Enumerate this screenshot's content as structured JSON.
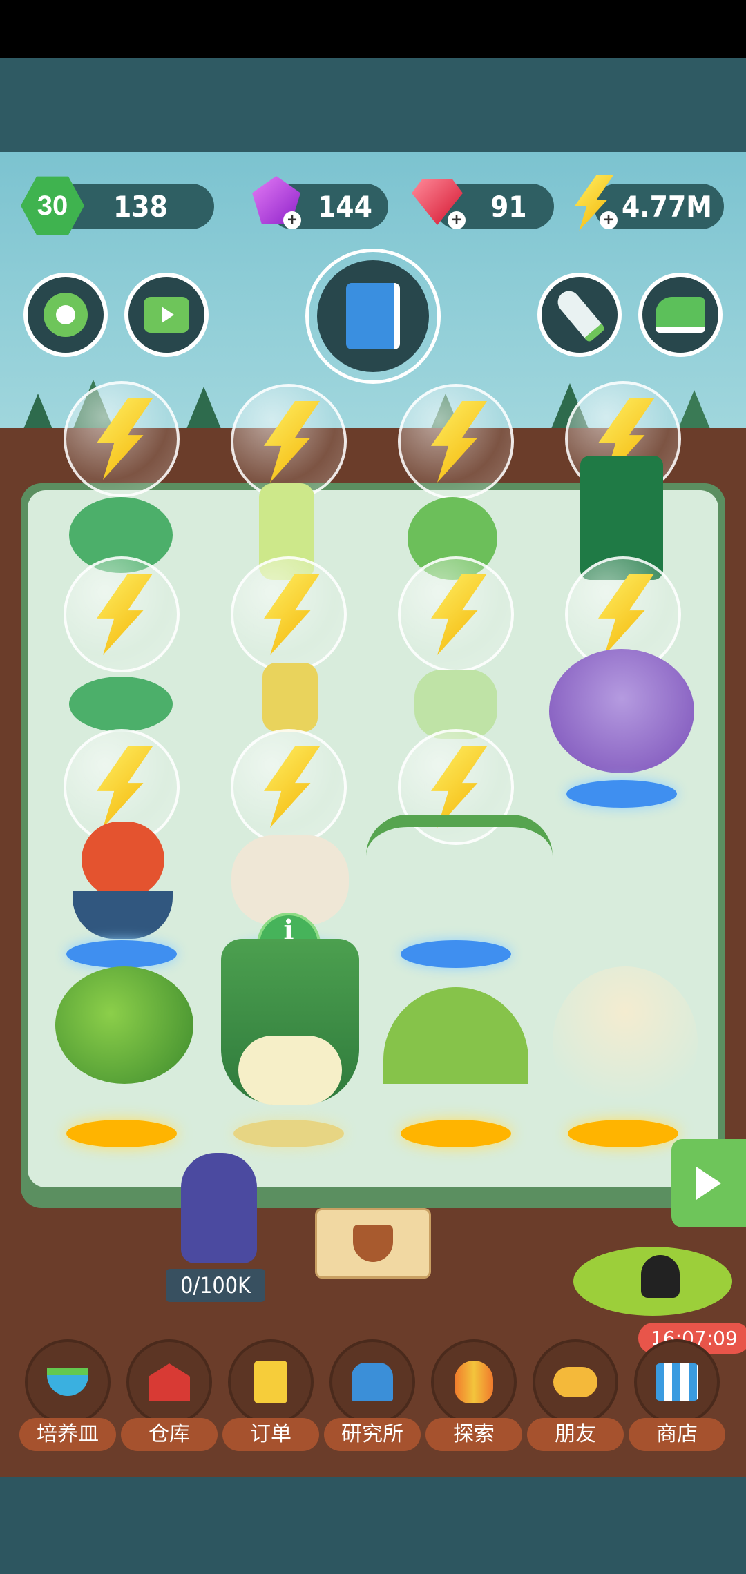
{
  "header": {
    "level": "30",
    "coins": "138",
    "gems": "144",
    "rubies": "91",
    "energy": "4.77M"
  },
  "quest": {
    "progress_label": "0/100K"
  },
  "info_button": {
    "label": "信息"
  },
  "shop_timer": "16:07:09",
  "nav": [
    {
      "label": "培养皿",
      "icon": "seedling-icon"
    },
    {
      "label": "仓库",
      "icon": "barn-icon"
    },
    {
      "label": "订单",
      "icon": "scroll-icon"
    },
    {
      "label": "研究所",
      "icon": "lab-icon"
    },
    {
      "label": "探索",
      "icon": "balloon-icon"
    },
    {
      "label": "朋友",
      "icon": "friends-icon"
    },
    {
      "label": "商店",
      "icon": "shop-icon"
    }
  ],
  "colors": {
    "accent_green": "#3fb34f",
    "field": "#d8ecdc",
    "nav_label": "#a6522e"
  }
}
